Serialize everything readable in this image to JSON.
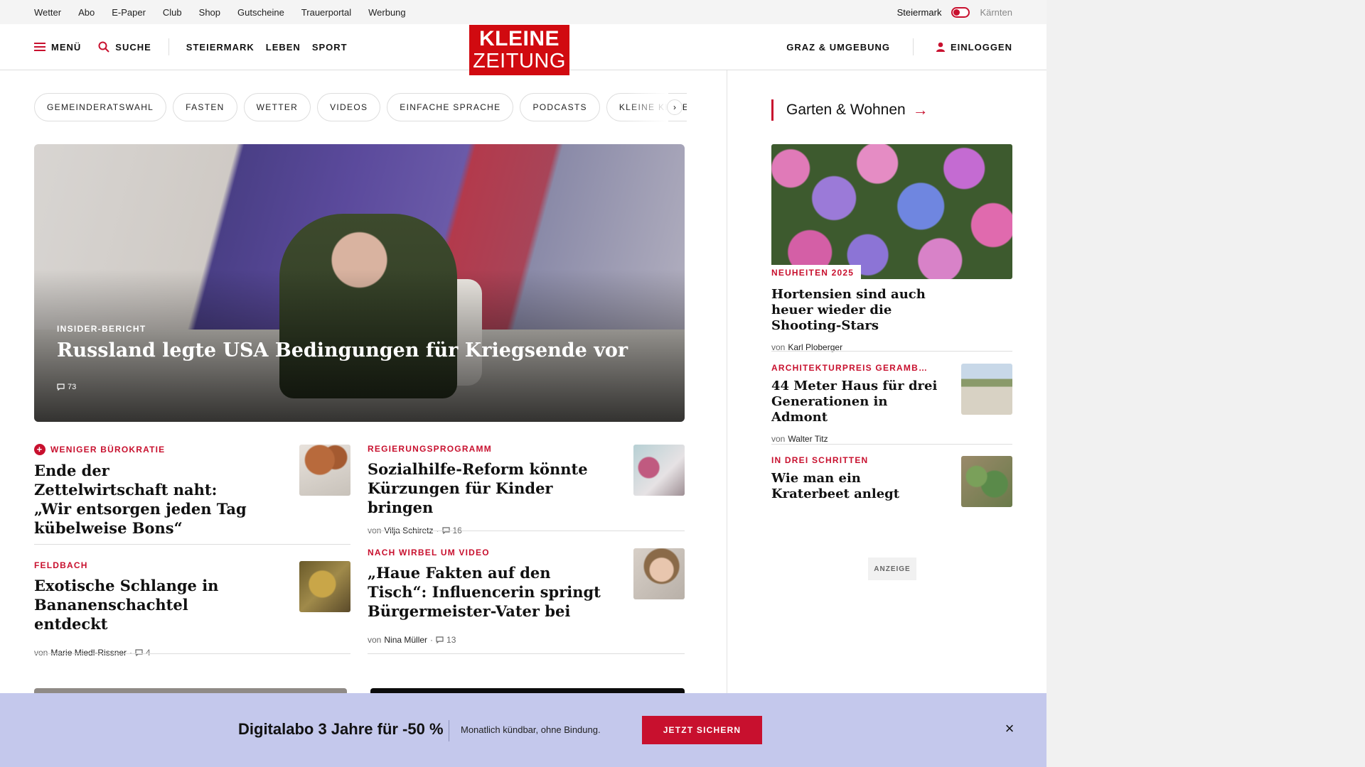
{
  "utility_bar": {
    "links": [
      "Wetter",
      "Abo",
      "E-Paper",
      "Club",
      "Shop",
      "Gutscheine",
      "Trauerportal",
      "Werbung"
    ],
    "region_active": "Steiermark",
    "region_inactive": "Kärnten"
  },
  "header": {
    "menu_label": "MENÜ",
    "search_label": "SUCHE",
    "nav": [
      "STEIERMARK",
      "LEBEN",
      "SPORT"
    ],
    "logo_line1": "KLEINE",
    "logo_line2": "ZEITUNG",
    "region_link": "GRAZ & UMGEBUNG",
    "login_label": "EINLOGGEN"
  },
  "topics": [
    "GEMEINDERATSWAHL",
    "FASTEN",
    "WETTER",
    "VIDEOS",
    "EINFACHE SPRACHE",
    "PODCASTS",
    "KLEINE KINDE"
  ],
  "topics_next": "›",
  "hero": {
    "kicker": "INSIDER-BERICHT",
    "title": "Russland legte USA Bedingungen für Kriegsende vor",
    "comments": "73"
  },
  "articles": [
    {
      "kicker": "WENIGER BÜROKRATIE",
      "title": "Ende der Zettelwirtschaft naht: „Wir entsorgen jeden Tag kübelweise Bons“"
    },
    {
      "kicker": "REGIERUNGSPROGRAMM",
      "title": "Sozialhilfe-Reform könnte Kürzungen für Kinder bringen",
      "by": "von",
      "author": "Vilja Schiretz",
      "comments": "16"
    },
    {
      "kicker": "FELDBACH",
      "title": "Exotische Schlange in Bananenschachtel entdeckt",
      "by": "von",
      "author": "Marie Miedl-Rissner",
      "comments": "4"
    },
    {
      "kicker": "NACH WIRBEL UM VIDEO",
      "title": "„Haue Fakten auf den Tisch“: Influencerin springt Bürgermeister-Vater bei",
      "by": "von",
      "author": "Nina Müller",
      "comments": "13"
    }
  ],
  "sidebar": {
    "section_title": "Garten & Wohnen",
    "items": [
      {
        "kicker": "NEUHEITEN 2025",
        "title": "Hortensien sind auch heuer wieder die Shooting-Stars",
        "by": "von",
        "author": "Karl Ploberger"
      },
      {
        "kicker": "ARCHITEKTURPREIS GERAMB…",
        "title": "44 Meter Haus für drei Generationen in Admont",
        "by": "von",
        "author": "Walter Titz"
      },
      {
        "kicker": "IN DREI SCHRITTEN",
        "title": "Wie man ein Kraterbeet anlegt"
      }
    ]
  },
  "ad_label": "ANZEIGE",
  "promo": {
    "headline": "Digitalabo 3 Jahre für -50 %",
    "subline": "Monatlich kündbar, ohne Bindung.",
    "cta": "JETZT SICHERN",
    "close": "×"
  },
  "colors": {
    "brand_red": "#d10a10",
    "accent_red": "#c8102e",
    "promo_bg": "#c4c8ec"
  }
}
